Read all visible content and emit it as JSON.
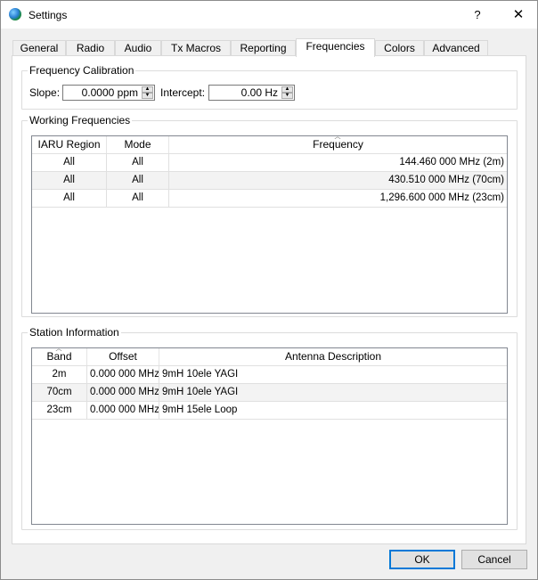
{
  "window": {
    "title": "Settings",
    "help_glyph": "?",
    "close_glyph": "✕"
  },
  "tabs": [
    {
      "label": "General"
    },
    {
      "label": "Radio"
    },
    {
      "label": "Audio"
    },
    {
      "label": "Tx Macros"
    },
    {
      "label": "Reporting"
    },
    {
      "label": "Frequencies",
      "active": true
    },
    {
      "label": "Colors"
    },
    {
      "label": "Advanced"
    }
  ],
  "calibration": {
    "title": "Frequency Calibration",
    "slope_label": "Slope:",
    "slope_value": "0.0000 ppm",
    "intercept_label": "Intercept:",
    "intercept_value": "0.00 Hz"
  },
  "working": {
    "title": "Working Frequencies",
    "headers": [
      "IARU Region",
      "Mode",
      "Frequency"
    ],
    "rows": [
      {
        "region": "All",
        "mode": "All",
        "frequency": "144.460 000 MHz (2m)"
      },
      {
        "region": "All",
        "mode": "All",
        "frequency": "430.510 000 MHz (70cm)"
      },
      {
        "region": "All",
        "mode": "All",
        "frequency": "1,296.600 000 MHz (23cm)"
      }
    ]
  },
  "station": {
    "title": "Station Information",
    "headers": [
      "Band",
      "Offset",
      "Antenna Description"
    ],
    "rows": [
      {
        "band": "2m",
        "offset": "0.000 000 MHz",
        "antenna": "9mH 10ele YAGI"
      },
      {
        "band": "70cm",
        "offset": "0.000 000 MHz",
        "antenna": "9mH 10ele YAGI"
      },
      {
        "band": "23cm",
        "offset": "0.000 000 MHz",
        "antenna": "9mH 15ele Loop"
      }
    ]
  },
  "buttons": {
    "ok": "OK",
    "cancel": "Cancel"
  },
  "colors": {
    "accent": "#0078d7",
    "alt_row": "#f3f3f3"
  }
}
